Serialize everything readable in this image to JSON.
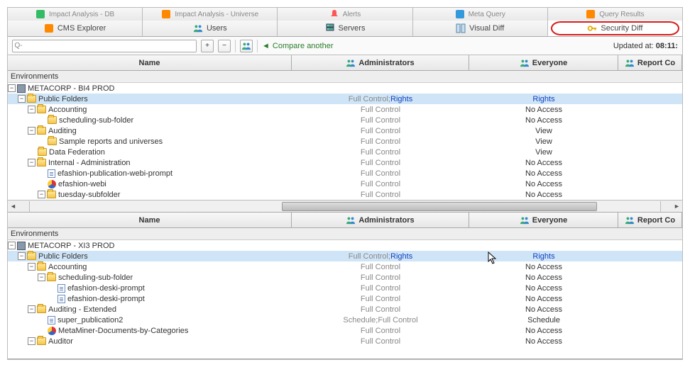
{
  "tabs_row1": [
    {
      "icon": "impact",
      "label": "Impact Analysis - DB"
    },
    {
      "icon": "impact2",
      "label": "Impact Analysis - Universe"
    },
    {
      "icon": "bell",
      "label": "Alerts"
    },
    {
      "icon": "sql",
      "label": "Meta Query"
    },
    {
      "icon": "results",
      "label": "Query Results"
    }
  ],
  "tabs_row2": [
    {
      "icon": "tree",
      "label": "CMS Explorer"
    },
    {
      "icon": "users",
      "label": "Users"
    },
    {
      "icon": "server",
      "label": "Servers"
    },
    {
      "icon": "diff",
      "label": "Visual Diff"
    },
    {
      "icon": "key",
      "label": "Security Diff",
      "active": true
    }
  ],
  "toolbar": {
    "search_prefix": "Q-",
    "search_value": "",
    "expand_title": "+",
    "collapse_title": "−",
    "compare_label": "Compare another",
    "updated_prefix": "Updated at: ",
    "updated_time": "08:11:"
  },
  "columns": {
    "name": "Name",
    "admin": "Administrators",
    "everyone": "Everyone",
    "report": "Report Co"
  },
  "pane_top": {
    "env_label": "Environments",
    "root": "METACORP - BI4 PROD",
    "rows": [
      {
        "depth": 1,
        "toggle": "-",
        "icon": "folder",
        "label": "Public Folders",
        "admin": "Full Control; ",
        "admin_link": "Rights",
        "every": "Rights",
        "every_link": true,
        "selected": true
      },
      {
        "depth": 2,
        "toggle": "-",
        "icon": "folder",
        "label": "Accounting",
        "admin": "Full Control",
        "every": "No Access",
        "gray": true
      },
      {
        "depth": 3,
        "toggle": "",
        "icon": "folder",
        "label": "scheduling-sub-folder",
        "admin": "Full Control",
        "every": "No Access",
        "gray": true
      },
      {
        "depth": 2,
        "toggle": "-",
        "icon": "folder",
        "label": "Auditing",
        "admin": "Full Control",
        "every": "View"
      },
      {
        "depth": 3,
        "toggle": "",
        "icon": "folder",
        "label": "Sample reports and universes",
        "admin": "Full Control",
        "every": "View"
      },
      {
        "depth": 2,
        "toggle": "",
        "icon": "folder",
        "label": "Data Federation",
        "admin": "Full Control",
        "every": "View"
      },
      {
        "depth": 2,
        "toggle": "-",
        "icon": "folder",
        "label": "Internal - Administration",
        "admin": "Full Control",
        "every": "No Access",
        "gray": true
      },
      {
        "depth": 3,
        "toggle": "",
        "icon": "doc",
        "label": "efashion-publication-webi-prompt",
        "admin": "Full Control",
        "every": "No Access",
        "gray": true
      },
      {
        "depth": 3,
        "toggle": "",
        "icon": "webi",
        "label": "efashion-webi",
        "admin": "Full Control",
        "every": "No Access",
        "gray": true
      },
      {
        "depth": 3,
        "toggle": "-",
        "icon": "folder",
        "label": "tuesday-subfolder",
        "admin": "Full Control",
        "every": "No Access",
        "gray": true
      }
    ]
  },
  "pane_bottom": {
    "env_label": "Environments",
    "root": "METACORP - XI3 PROD",
    "rows": [
      {
        "depth": 1,
        "toggle": "-",
        "icon": "folder",
        "label": "Public Folders",
        "admin": "Full Control; ",
        "admin_link": "Rights",
        "every": "Rights",
        "every_link": true,
        "selected": true
      },
      {
        "depth": 2,
        "toggle": "-",
        "icon": "folder",
        "label": "Accounting",
        "admin": "Full Control",
        "every": "No Access",
        "gray": true
      },
      {
        "depth": 3,
        "toggle": "-",
        "icon": "folder",
        "label": "scheduling-sub-folder",
        "admin": "Full Control",
        "every": "No Access",
        "gray": true
      },
      {
        "depth": 4,
        "toggle": "",
        "icon": "doc",
        "label": "efashion-deski-prompt",
        "admin": "Full Control",
        "every": "No Access",
        "gray": true
      },
      {
        "depth": 4,
        "toggle": "",
        "icon": "doc",
        "label": "efashion-deski-prompt",
        "admin": "Full Control",
        "every": "No Access",
        "gray": true
      },
      {
        "depth": 2,
        "toggle": "-",
        "icon": "folder",
        "label": "Auditing - Extended",
        "admin": "Full Control",
        "every": "No Access",
        "gray": true
      },
      {
        "depth": 3,
        "toggle": "",
        "icon": "doc",
        "label": "super_publication2",
        "admin": "Schedule; ",
        "admin_suffix": "Full Control",
        "every": "Schedule"
      },
      {
        "depth": 3,
        "toggle": "",
        "icon": "webi",
        "label": "MetaMiner-Documents-by-Categories",
        "admin": "Full Control",
        "every": "No Access",
        "gray": true
      },
      {
        "depth": 2,
        "toggle": "-",
        "icon": "folder",
        "label": "Auditor",
        "admin": "Full Control",
        "every": "No Access",
        "gray": true
      }
    ]
  }
}
